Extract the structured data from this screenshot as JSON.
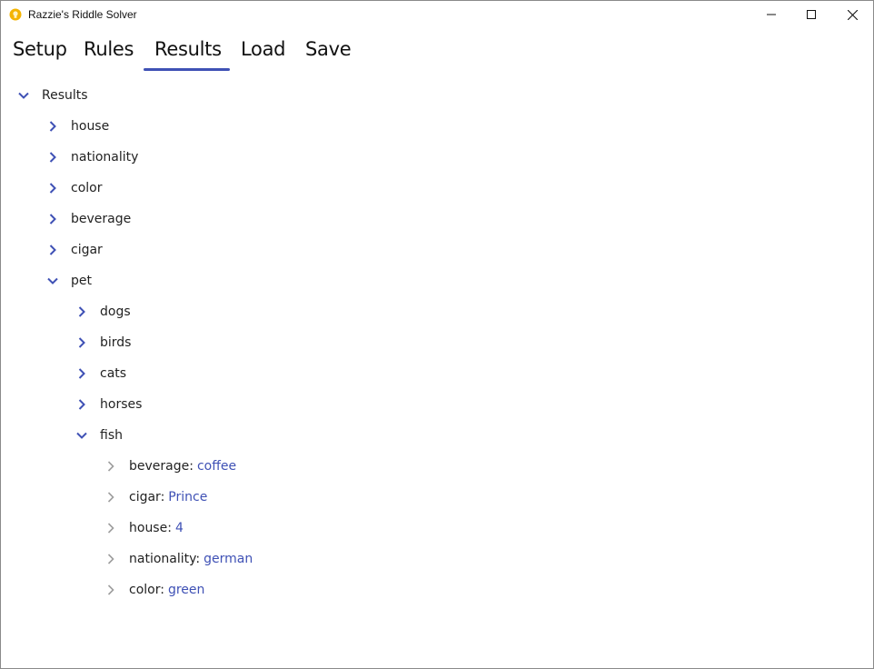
{
  "window": {
    "title": "Razzie's Riddle Solver"
  },
  "tabs": [
    {
      "label": "Setup"
    },
    {
      "label": "Rules"
    },
    {
      "label": "Results"
    },
    {
      "label": "Load"
    },
    {
      "label": "Save"
    }
  ],
  "active_tab": "Results",
  "colors": {
    "accent": "#3f51b5",
    "chevron_expandable": "#3f51b5",
    "chevron_leaf": "#9e9e9e"
  },
  "tree": {
    "root": {
      "label": "Results"
    },
    "categories": [
      {
        "label": "house"
      },
      {
        "label": "nationality"
      },
      {
        "label": "color"
      },
      {
        "label": "beverage"
      },
      {
        "label": "cigar"
      },
      {
        "label": "pet"
      }
    ],
    "pets": [
      {
        "label": "dogs"
      },
      {
        "label": "birds"
      },
      {
        "label": "cats"
      },
      {
        "label": "horses"
      },
      {
        "label": "fish"
      }
    ],
    "fish_details": [
      {
        "key": "beverage:",
        "value": "coffee"
      },
      {
        "key": "cigar:",
        "value": "Prince"
      },
      {
        "key": "house:",
        "value": "4"
      },
      {
        "key": "nationality:",
        "value": "german"
      },
      {
        "key": "color:",
        "value": "green"
      }
    ]
  }
}
